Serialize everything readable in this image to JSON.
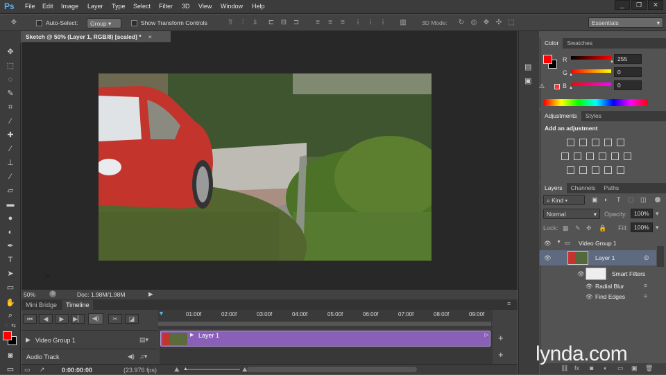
{
  "app": {
    "logo": "Ps"
  },
  "menu": [
    "File",
    "Edit",
    "Image",
    "Layer",
    "Type",
    "Select",
    "Filter",
    "3D",
    "View",
    "Window",
    "Help"
  ],
  "window_controls": [
    "_",
    "❐",
    "✕"
  ],
  "options": {
    "auto_select_label": "Auto-Select:",
    "auto_select_value": "Group",
    "show_transform_label": "Show Transform Controls",
    "mode_3d_label": "3D Mode:",
    "workspace": "Essentials"
  },
  "document": {
    "tab_title": "Sketch @ 50% (Layer 1, RGB/8) [scaled] *",
    "zoom": "50%",
    "doc_info": "Doc: 1.98M/1.98M"
  },
  "timeline": {
    "tabs": [
      "Mini Bridge",
      "Timeline"
    ],
    "ruler": [
      "01:00f",
      "02:00f",
      "03:00f",
      "04:00f",
      "05:00f",
      "06:00f",
      "07:00f",
      "08:00f",
      "09:00f"
    ],
    "tracks": [
      {
        "name": "Video Group 1"
      },
      {
        "name": "Audio Track"
      }
    ],
    "clip_label": "Layer 1",
    "timecode": "0:00:00:00",
    "fps": "(23.976 fps)",
    "clip_color": "#8a5fb8"
  },
  "color_panel": {
    "tabs": [
      "Color",
      "Swatches"
    ],
    "channels": [
      {
        "label": "R",
        "value": "255",
        "fraction": 1.0
      },
      {
        "label": "G",
        "value": "0",
        "fraction": 0.0
      },
      {
        "label": "B",
        "value": "0",
        "fraction": 0.0
      }
    ],
    "foreground": "#ff0000",
    "background": "#000000"
  },
  "adjustments_panel": {
    "tabs": [
      "Adjustments",
      "Styles"
    ],
    "heading": "Add an adjustment"
  },
  "layers_panel": {
    "tabs": [
      "Layers",
      "Channels",
      "Paths"
    ],
    "filter": "Kind",
    "blend_mode": "Normal",
    "opacity_label": "Opacity:",
    "opacity": "100%",
    "lock_label": "Lock:",
    "fill_label": "Fill:",
    "fill": "100%",
    "layers": [
      {
        "name": "Video Group 1"
      },
      {
        "name": "Layer 1"
      },
      {
        "name": "Smart Filters"
      },
      {
        "name": "Radial Blur"
      },
      {
        "name": "Find Edges"
      }
    ]
  },
  "watermark": "lynda.com"
}
